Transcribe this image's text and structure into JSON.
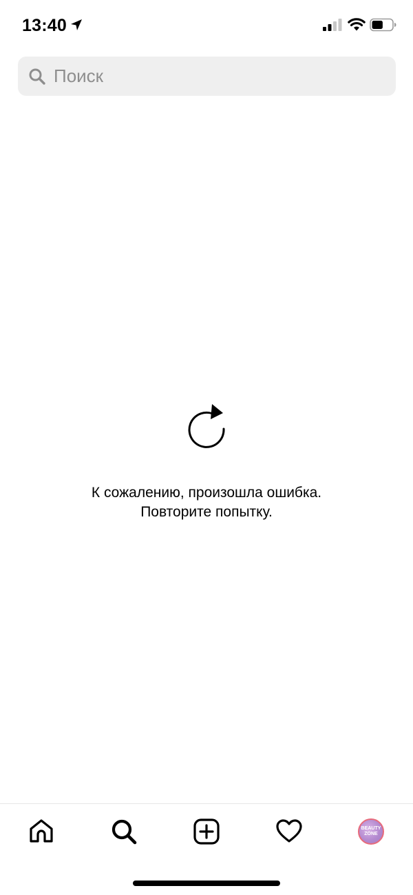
{
  "status_bar": {
    "time": "13:40",
    "icons": [
      "location-arrow-icon",
      "cellular-signal-icon",
      "wifi-icon",
      "battery-icon"
    ],
    "battery_level": 0.55
  },
  "search": {
    "placeholder": "Поиск",
    "value": ""
  },
  "error": {
    "icon": "reload-icon",
    "line1": "К сожалению, произошла ошибка.",
    "line2": "Повторите попытку."
  },
  "tab_bar": {
    "tabs": [
      {
        "name": "home",
        "icon": "home-icon",
        "active": false
      },
      {
        "name": "search",
        "icon": "search-icon",
        "active": true
      },
      {
        "name": "create",
        "icon": "plus-square-icon",
        "active": false
      },
      {
        "name": "activity",
        "icon": "heart-icon",
        "active": false
      },
      {
        "name": "profile",
        "icon": "avatar",
        "active": false
      }
    ],
    "avatar_text": {
      "line1": "BEAUTY",
      "line2": "ZONE"
    }
  },
  "colors": {
    "background": "#ffffff",
    "search_bg": "#efefef",
    "placeholder": "#8e8e8e",
    "text": "#000000",
    "avatar_ring": "#e86b7b"
  }
}
